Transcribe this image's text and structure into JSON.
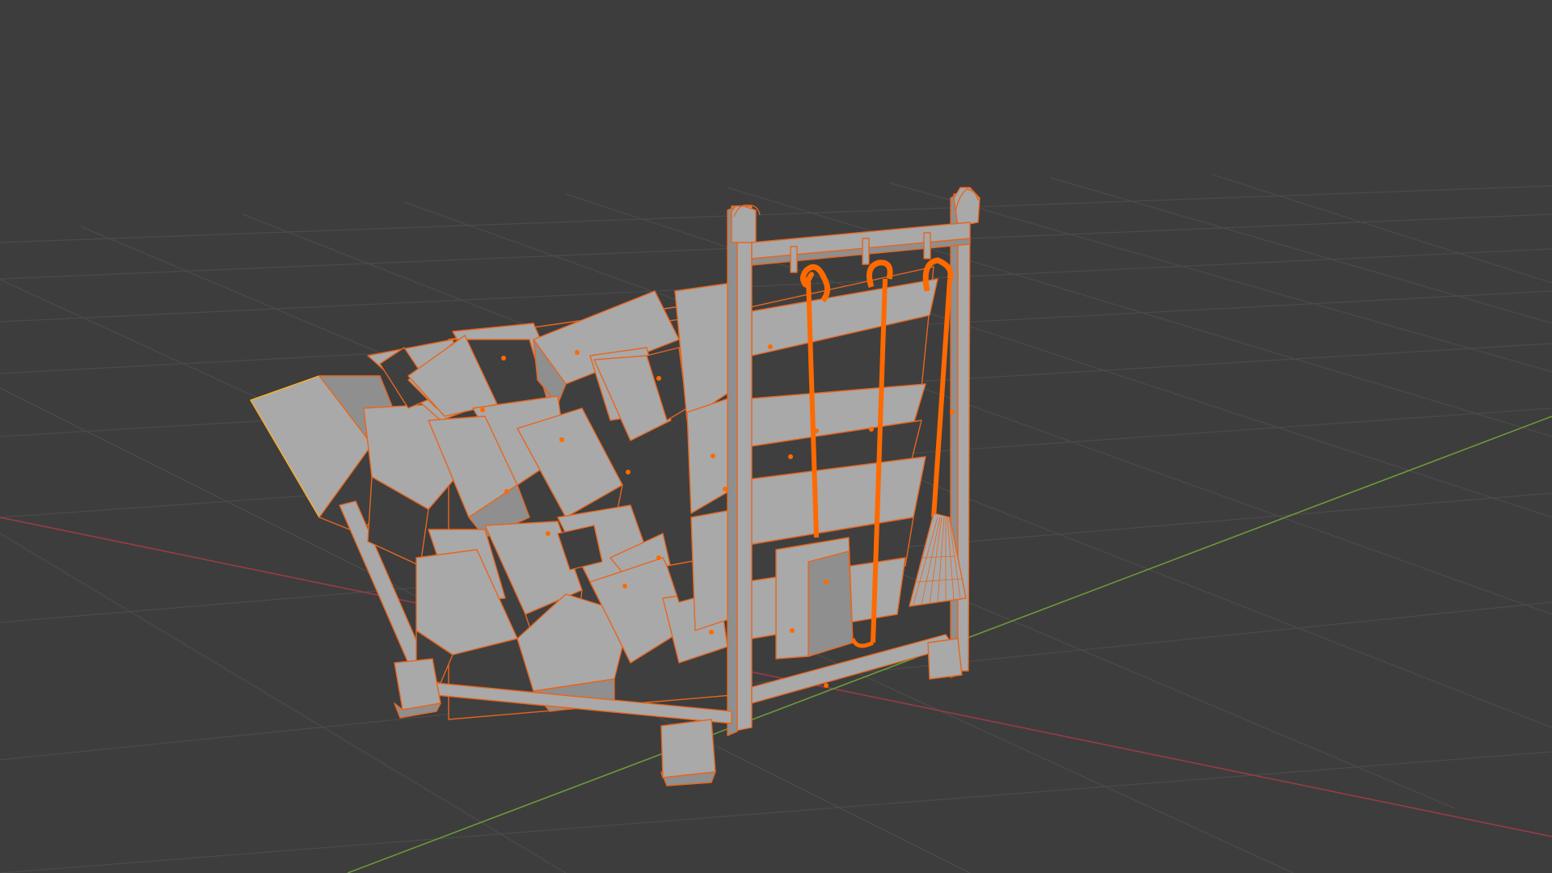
{
  "viewport": {
    "mode": "edit-mode-wireframe-overlay",
    "background_color": "#3d3d3d",
    "grid_color": "#4a4a4a",
    "x_axis_color": "#9a3b46",
    "y_axis_color": "#6c9a36"
  },
  "scene": {
    "object": "firewood-rack",
    "contents": [
      "log-stack",
      "shovel",
      "poker",
      "broom"
    ],
    "mesh_face_color": "#a9a9a9",
    "mesh_dark_color": "#3f3f3f",
    "selection_color": "#ff6a00",
    "active_edge_color": "#ffb020"
  }
}
